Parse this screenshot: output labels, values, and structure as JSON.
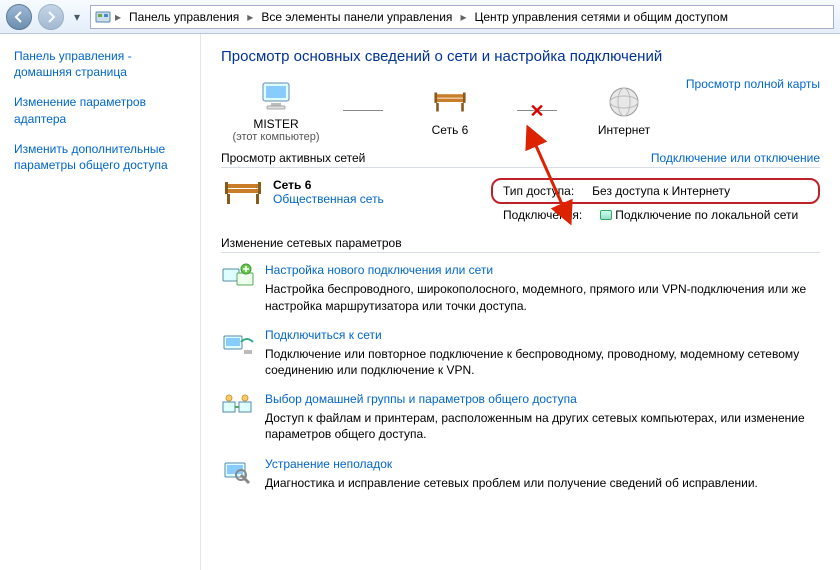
{
  "breadcrumbs": {
    "level1": "Панель управления",
    "level2": "Все элементы панели управления",
    "level3": "Центр управления сетями и общим доступом"
  },
  "sidebar": {
    "home": "Панель управления - домашняя страница",
    "adapter": "Изменение параметров адаптера",
    "sharing": "Изменить дополнительные параметры общего доступа"
  },
  "content": {
    "title": "Просмотр основных сведений о сети и настройка подключений",
    "full_map": "Просмотр полной карты",
    "map": {
      "computer": "MISTER",
      "computer_sub": "(этот компьютер)",
      "network": "Сеть 6",
      "internet": "Интернет"
    },
    "active_header": "Просмотр активных сетей",
    "active_link": "Подключение или отключение",
    "net": {
      "name": "Сеть 6",
      "type": "Общественная сеть"
    },
    "details": {
      "access_k": "Тип доступа:",
      "access_v": "Без доступа к Интернету",
      "conn_k": "Подключения:",
      "conn_v": "Подключение по локальной сети"
    },
    "change_header": "Изменение сетевых параметров",
    "opts": [
      {
        "title": "Настройка нового подключения или сети",
        "desc": "Настройка беспроводного, широкополосного, модемного, прямого или VPN-подключения или же настройка маршрутизатора или точки доступа."
      },
      {
        "title": "Подключиться к сети",
        "desc": "Подключение или повторное подключение к беспроводному, проводному, модемному сетевому соединению или подключение к VPN."
      },
      {
        "title": "Выбор домашней группы и параметров общего доступа",
        "desc": "Доступ к файлам и принтерам, расположенным на других сетевых компьютерах, или изменение параметров общего доступа."
      },
      {
        "title": "Устранение неполадок",
        "desc": "Диагностика и исправление сетевых проблем или получение сведений об исправлении."
      }
    ]
  }
}
